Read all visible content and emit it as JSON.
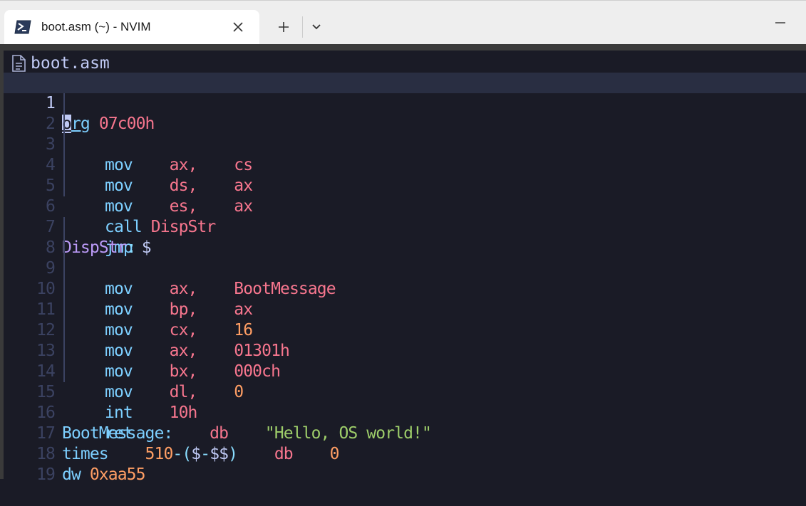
{
  "window": {
    "tab_title": "boot.asm (~) - NVIM",
    "tab_icon": "terminal-icon",
    "close_icon": "close-icon",
    "new_tab_icon": "plus-icon",
    "dropdown_icon": "chevron-down-icon",
    "minimize_icon": "minimize-icon"
  },
  "editor": {
    "filename": "boot.asm",
    "file_icon": "file-icon",
    "cursor_line": 1,
    "lines": [
      {
        "num": "1",
        "t": [
          "org",
          " ",
          "07c00h"
        ]
      },
      {
        "num": "2",
        "t": [
          "mov",
          "    ",
          "ax,",
          "    ",
          "cs"
        ]
      },
      {
        "num": "3",
        "t": [
          "mov",
          "    ",
          "ds,",
          "    ",
          "ax"
        ]
      },
      {
        "num": "4",
        "t": [
          "mov",
          "    ",
          "es,",
          "    ",
          "ax"
        ]
      },
      {
        "num": "5",
        "t": [
          "call",
          " ",
          "DispStr"
        ]
      },
      {
        "num": "6",
        "t": [
          "jmp",
          " ",
          "$"
        ]
      },
      {
        "num": "7",
        "t": [
          "DispStr",
          ":"
        ]
      },
      {
        "num": "8",
        "t": [
          "mov",
          "    ",
          "ax,",
          "    ",
          "BootMessage"
        ]
      },
      {
        "num": "9",
        "t": [
          "mov",
          "    ",
          "bp,",
          "    ",
          "ax"
        ]
      },
      {
        "num": "10",
        "t": [
          "mov",
          "    ",
          "cx,",
          "    ",
          "16"
        ]
      },
      {
        "num": "11",
        "t": [
          "mov",
          "    ",
          "ax,",
          "    ",
          "01301h"
        ]
      },
      {
        "num": "12",
        "t": [
          "mov",
          "    ",
          "bx,",
          "    ",
          "000ch"
        ]
      },
      {
        "num": "13",
        "t": [
          "mov",
          "    ",
          "dl,",
          "    ",
          "0"
        ]
      },
      {
        "num": "14",
        "t": [
          "int",
          "    ",
          "10h"
        ]
      },
      {
        "num": "15",
        "t": [
          "ret"
        ]
      },
      {
        "num": "16",
        "t": [
          "BootMessage:",
          "    ",
          "db",
          "    ",
          "\"Hello, OS world!\""
        ]
      },
      {
        "num": "17",
        "t": [
          "times",
          "    ",
          "510",
          "-(",
          "$",
          "-",
          "$$",
          ")",
          "    ",
          "db",
          "    ",
          "0"
        ]
      },
      {
        "num": "18",
        "t": [
          "dw",
          " ",
          "0xaa55"
        ]
      },
      {
        "num": "19",
        "t": []
      }
    ]
  },
  "colors": {
    "background": "#1a1b26",
    "cursorline": "#292e42",
    "keyword": "#7dcfff",
    "register": "#f7768e",
    "number": "#ff9e64",
    "label": "#bb9af7",
    "string": "#9ece6a",
    "line_number": "#3b4261"
  }
}
